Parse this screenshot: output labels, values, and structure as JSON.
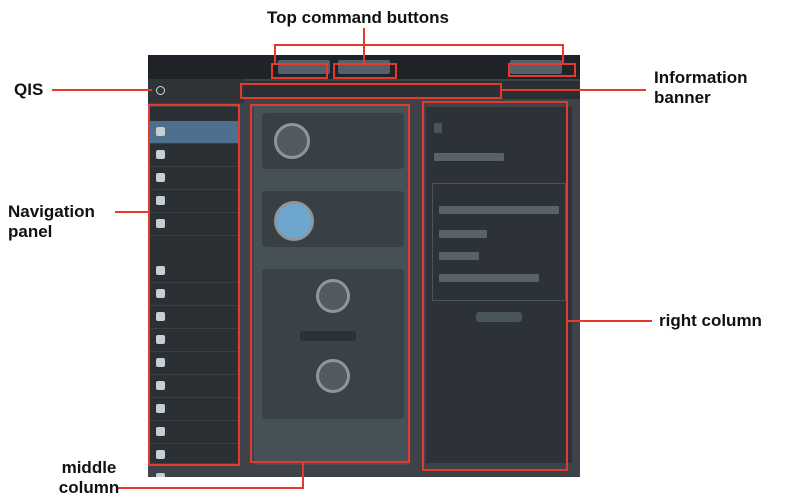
{
  "callouts": {
    "top_command_buttons": "Top command buttons",
    "qis": "QIS",
    "information_banner": "Information banner",
    "navigation_panel": "Navigation panel",
    "right_column": "right column",
    "middle_column": "middle column"
  },
  "accent_color": "#e23a2c"
}
